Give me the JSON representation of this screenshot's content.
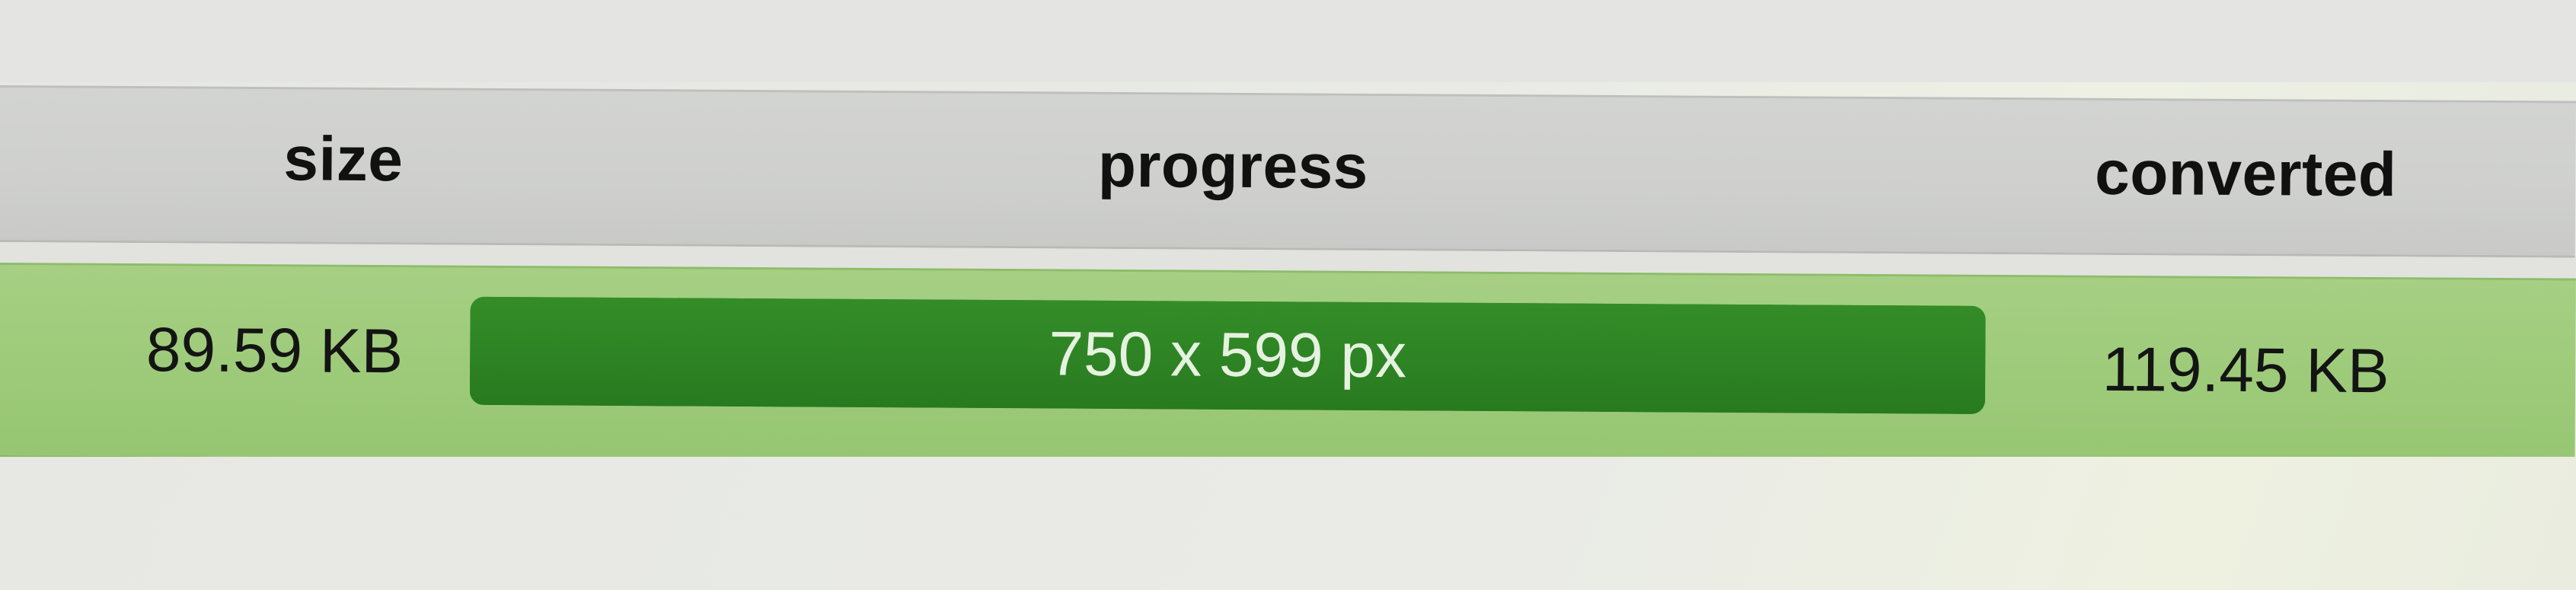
{
  "table": {
    "columns": {
      "size": "size",
      "progress": "progress",
      "converted": "converted"
    },
    "rows": [
      {
        "size": "89.59 KB",
        "progress_label": "750 x 599 px",
        "progress_fraction": 1.0,
        "converted": "119.45 KB"
      }
    ]
  },
  "colors": {
    "row_highlight": "#9ecb7a",
    "progress_bar": "#2e8424",
    "header_background": "#cfd0ce"
  }
}
